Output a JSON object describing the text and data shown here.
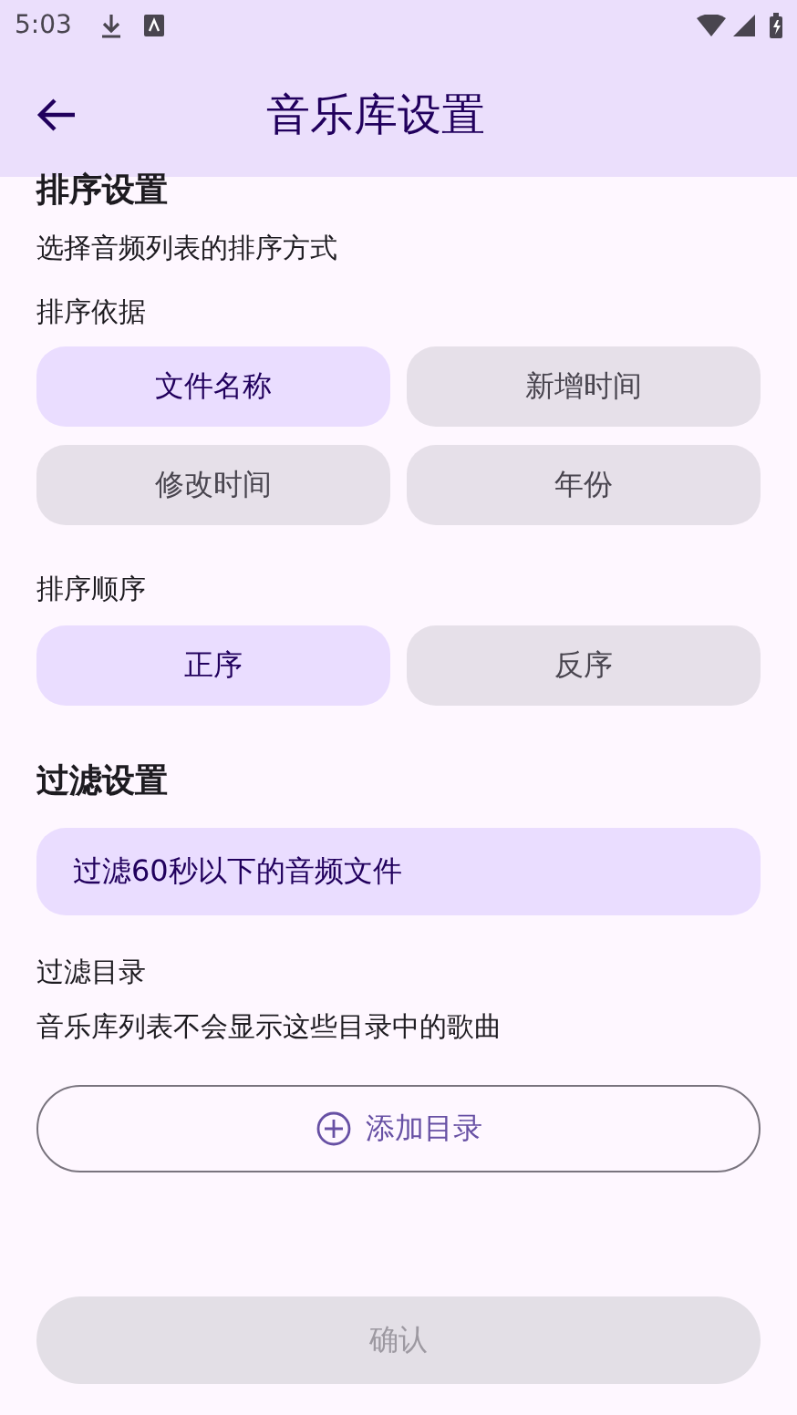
{
  "status_bar": {
    "time": "5:03"
  },
  "app_bar": {
    "title": "音乐库设置"
  },
  "sort": {
    "title": "排序设置",
    "subtitle": "选择音频列表的排序方式",
    "by_label": "排序依据",
    "by_options": [
      {
        "label": "文件名称",
        "selected": true
      },
      {
        "label": "新增时间",
        "selected": false
      },
      {
        "label": "修改时间",
        "selected": false
      },
      {
        "label": "年份",
        "selected": false
      }
    ],
    "order_label": "排序顺序",
    "order_options": [
      {
        "label": "正序",
        "selected": true
      },
      {
        "label": "反序",
        "selected": false
      }
    ]
  },
  "filter": {
    "title": "过滤设置",
    "short_audio": {
      "label": "过滤60秒以下的音频文件",
      "on": true
    },
    "dirs_label": "过滤目录",
    "dirs_desc": "音乐库列表不会显示这些目录中的歌曲",
    "add_button": "添加目录"
  },
  "confirm": {
    "label": "确认",
    "disabled": true
  }
}
